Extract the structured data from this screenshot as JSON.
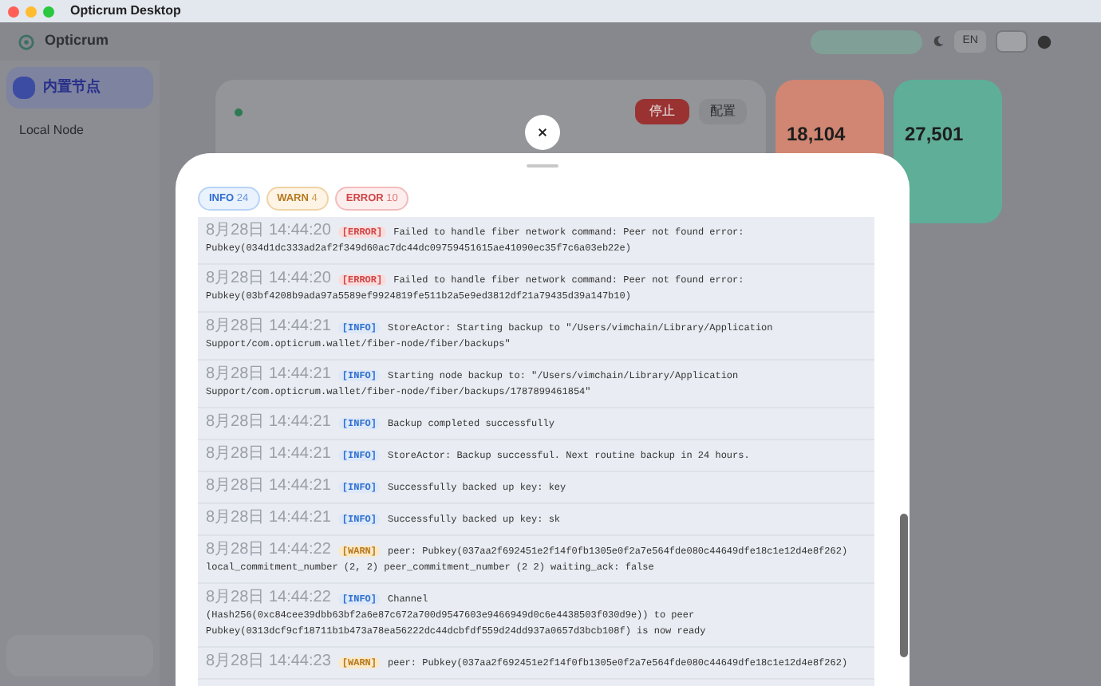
{
  "window": {
    "title": "Opticrum Desktop"
  },
  "app": {
    "brand": "Opticrum",
    "language": "EN",
    "sidebar": {
      "items": [
        {
          "label": "内置节点",
          "selected": true
        },
        {
          "label": "Local Node",
          "selected": false
        }
      ]
    },
    "node_card": {
      "buttons": [
        "停止",
        "配置"
      ]
    },
    "stats": [
      {
        "value": "18,104",
        "color": "#d08672"
      },
      {
        "value": "27,501",
        "color": "#5fae98"
      }
    ]
  },
  "log_sheet": {
    "filters": [
      {
        "kind": "info",
        "label": "INFO",
        "count": "24"
      },
      {
        "kind": "warn",
        "label": "WARN",
        "count": "4"
      },
      {
        "kind": "error",
        "label": "ERROR",
        "count": "10"
      }
    ],
    "entries": [
      {
        "time": "8月28日 14:44:20",
        "kind": "error",
        "tag": "[ERROR]",
        "message": "Failed to handle fiber network command: Peer not found error: Pubkey(034d1dc333ad2af2f349d60ac7dc44dc09759451615ae41090ec35f7c6a03eb22e)"
      },
      {
        "time": "8月28日 14:44:20",
        "kind": "error",
        "tag": "[ERROR]",
        "message": "Failed to handle fiber network command: Peer not found error: Pubkey(03bf4208b9ada97a5589ef9924819fe511b2a5e9ed3812df21a79435d39a147b10)"
      },
      {
        "time": "8月28日 14:44:21",
        "kind": "info",
        "tag": "[INFO]",
        "message": "StoreActor: Starting backup to \"/Users/vimchain/Library/Application Support/com.opticrum.wallet/fiber-node/fiber/backups\""
      },
      {
        "time": "8月28日 14:44:21",
        "kind": "info",
        "tag": "[INFO]",
        "message": "Starting node backup to: \"/Users/vimchain/Library/Application Support/com.opticrum.wallet/fiber-node/fiber/backups/1787899461854\""
      },
      {
        "time": "8月28日 14:44:21",
        "kind": "info",
        "tag": "[INFO]",
        "message": "Backup completed successfully"
      },
      {
        "time": "8月28日 14:44:21",
        "kind": "info",
        "tag": "[INFO]",
        "message": "StoreActor: Backup successful. Next routine backup in 24 hours."
      },
      {
        "time": "8月28日 14:44:21",
        "kind": "info",
        "tag": "[INFO]",
        "message": "Successfully backed up key: key"
      },
      {
        "time": "8月28日 14:44:21",
        "kind": "info",
        "tag": "[INFO]",
        "message": "Successfully backed up key: sk"
      },
      {
        "time": "8月28日 14:44:22",
        "kind": "warn",
        "tag": "[WARN]",
        "message": "peer: Pubkey(037aa2f692451e2f14f0fb1305e0f2a7e564fde080c44649dfe18c1e12d4e8f262) local_commitment_number (2, 2) peer_commitment_number (2 2) waiting_ack: false"
      },
      {
        "time": "8月28日 14:44:22",
        "kind": "info",
        "tag": "[INFO]",
        "message": "Channel (Hash256(0xc84cee39dbb63bf2a6e87c672a700d9547603e9466949d0c6e4438503f030d9e)) to peer Pubkey(0313dcf9cf18711b1b473a78ea56222dc44dcbfdf559d24dd937a0657d3bcb108f) is now ready"
      },
      {
        "time": "8月28日 14:44:23",
        "kind": "warn",
        "tag": "[WARN]",
        "message": "peer: Pubkey(037aa2f692451e2f14f0fb1305e0f2a7e564fde080c44649dfe18c1e12d4e8f262)"
      }
    ]
  }
}
